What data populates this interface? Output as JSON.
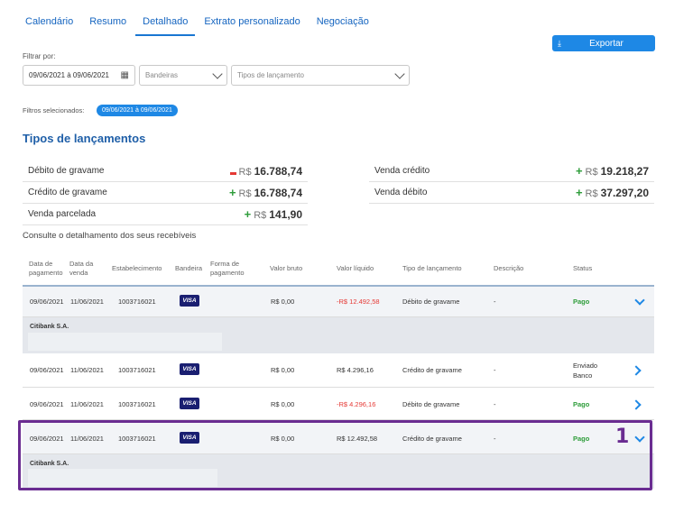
{
  "tabs": [
    "Calendário",
    "Resumo",
    "Detalhado",
    "Extrato personalizado",
    "Negociação"
  ],
  "active_tab": "Detalhado",
  "export_button": {
    "label": "Exportar",
    "icon": "download-icon"
  },
  "filter": {
    "label": "Filtrar por:",
    "date_range": "09/06/2021 à 09/06/2021",
    "flags_placeholder": "Bandeiras",
    "types_placeholder": "Tipos de lançamento"
  },
  "selected_filters": {
    "label": "Filtros selecionados:",
    "chip": "09/06/2021 à 09/06/2021"
  },
  "section_title": "Tipos de lançamentos",
  "summary": {
    "currency": "R$",
    "left": [
      {
        "label": "Débito de gravame",
        "sign": "-",
        "value": "16.788,74"
      },
      {
        "label": "Crédito de gravame",
        "sign": "+",
        "value": "16.788,74"
      },
      {
        "label": "Venda parcelada",
        "sign": "+",
        "value": "141,90"
      }
    ],
    "right": [
      {
        "label": "Venda crédito",
        "sign": "+",
        "value": "19.218,27"
      },
      {
        "label": "Venda débito",
        "sign": "+",
        "value": "37.297,20"
      }
    ]
  },
  "detail_subtitle": "Consulte o detalhamento dos seus recebíveis",
  "table": {
    "headers": {
      "data_pagamento": [
        "Data de",
        "pagamento"
      ],
      "data_venda": [
        "Data da",
        "venda"
      ],
      "estabelecimento": "Estabelecimento",
      "bandeira": "Bandeira",
      "forma_pagamento": [
        "Forma de",
        "pagamento"
      ],
      "valor_bruto": "Valor bruto",
      "valor_liquido": "Valor líquido",
      "tipo_lancamento": "Tipo de lançamento",
      "descricao": "Descrição",
      "status": "Status"
    },
    "rows": [
      {
        "pay_date": "09/06/2021",
        "sale_date": "11/06/2021",
        "establishment": "1003716021",
        "flag": "VISA",
        "gross": "R$ 0,00",
        "net": "-R$ 12.492,58",
        "type": "Débito de gravame",
        "description": "-",
        "status": "Pago",
        "expanded": true,
        "detail_bank": "Citibank S.A."
      },
      {
        "pay_date": "09/06/2021",
        "sale_date": "11/06/2021",
        "establishment": "1003716021",
        "flag": "VISA",
        "gross": "R$ 0,00",
        "net": "R$ 4.296,16",
        "type": "Crédito de gravame",
        "description": "-",
        "status_line1": "Enviado",
        "status_line2": "Banco",
        "expanded": false
      },
      {
        "pay_date": "09/06/2021",
        "sale_date": "11/06/2021",
        "establishment": "1003716021",
        "flag": "VISA",
        "gross": "R$ 0,00",
        "net": "-R$ 4.296,16",
        "type": "Débito de gravame",
        "description": "-",
        "status": "Pago",
        "expanded": false
      },
      {
        "pay_date": "09/06/2021",
        "sale_date": "11/06/2021",
        "establishment": "1003716021",
        "flag": "VISA",
        "gross": "R$ 0,00",
        "net": "R$ 12.492,58",
        "type": "Crédito de gravame",
        "description": "-",
        "status": "Pago",
        "expanded": true,
        "detail_bank": "Citibank S.A."
      }
    ]
  },
  "annotation_marker": "1",
  "colors": {
    "accent": "#1e88e5",
    "paid": "#2e9d3a",
    "negative": "#e53935",
    "highlight": "#6a2c91"
  }
}
